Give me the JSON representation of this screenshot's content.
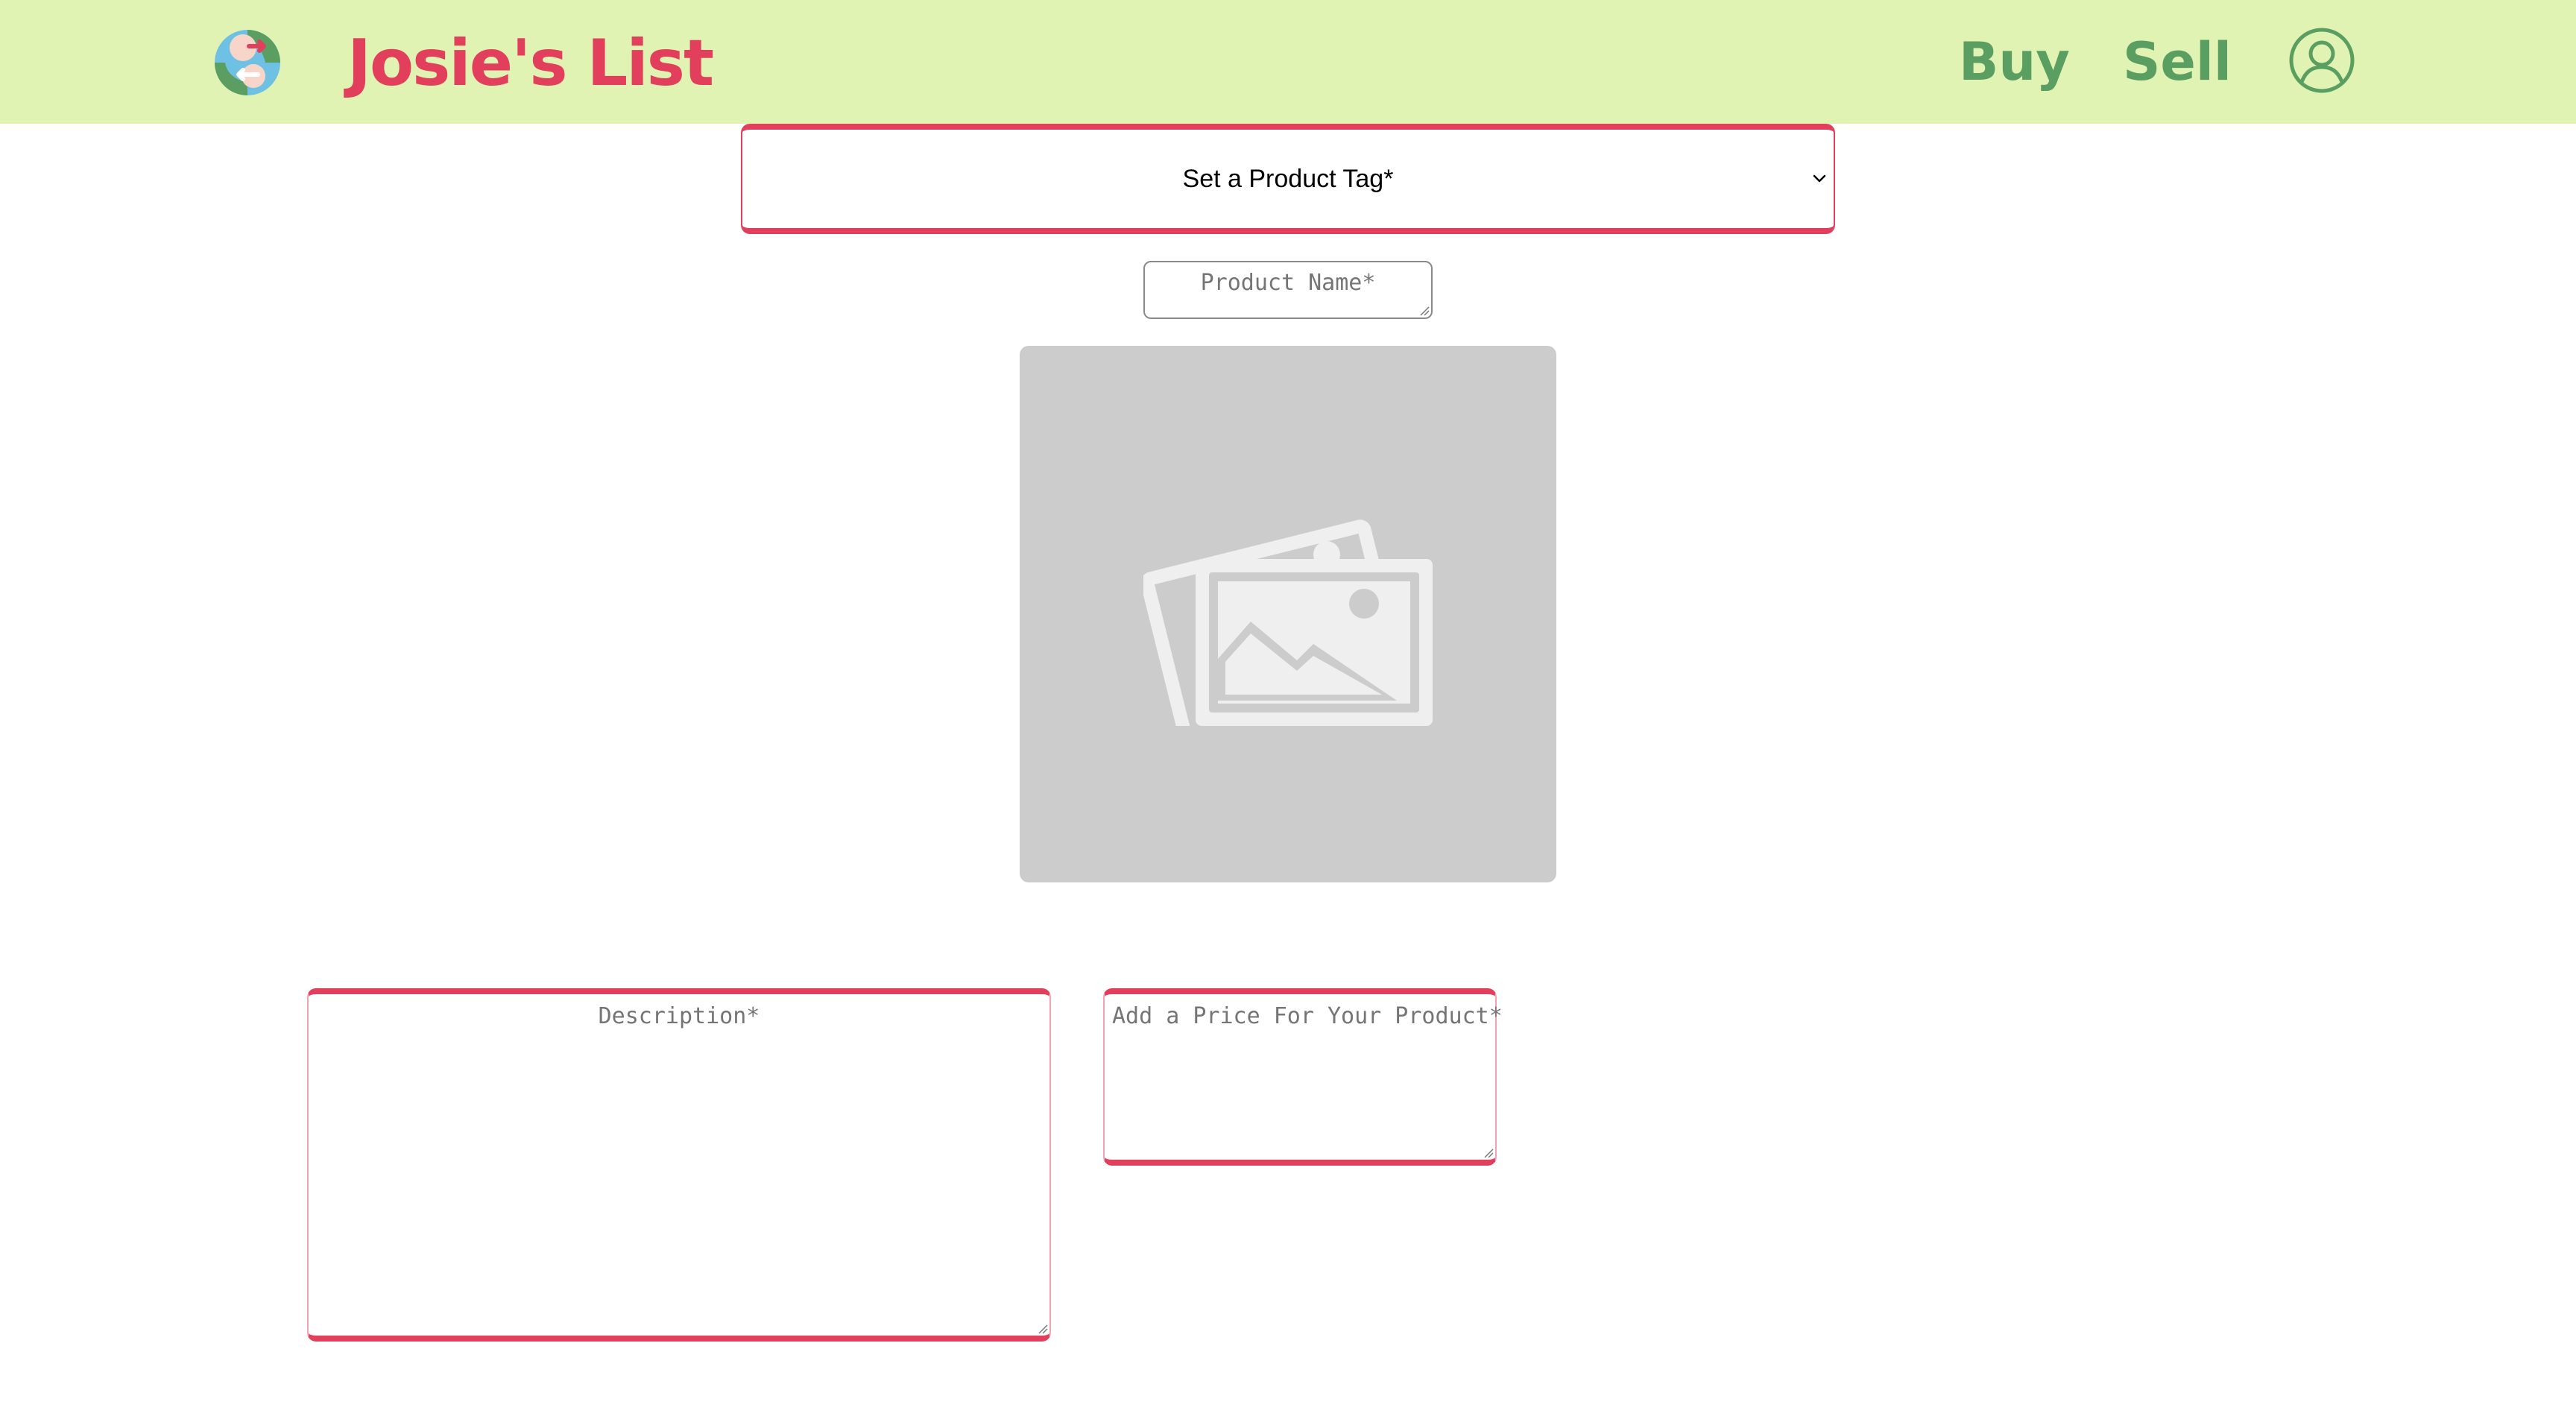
{
  "colors": {
    "header_background": "#e1f3b3",
    "brand": "#e23f5c",
    "nav": "#5a9e62",
    "field_accent": "#e23f5c",
    "image_placeholder": "#cccccc"
  },
  "header": {
    "logo_icon": "globe-exchange-logo-icon",
    "brand_name": "Josie's List",
    "nav": {
      "buy_label": "Buy",
      "sell_label": "Sell"
    },
    "profile_icon": "user-circle-icon"
  },
  "form": {
    "product_tag": {
      "selected": "Set a Product Tag*"
    },
    "product_name": {
      "placeholder": "Product Name*"
    },
    "image_upload": {
      "icon": "image-placeholder-icon"
    },
    "description": {
      "placeholder": "Description*"
    },
    "price": {
      "placeholder": "Add a Price For Your Product*"
    }
  }
}
